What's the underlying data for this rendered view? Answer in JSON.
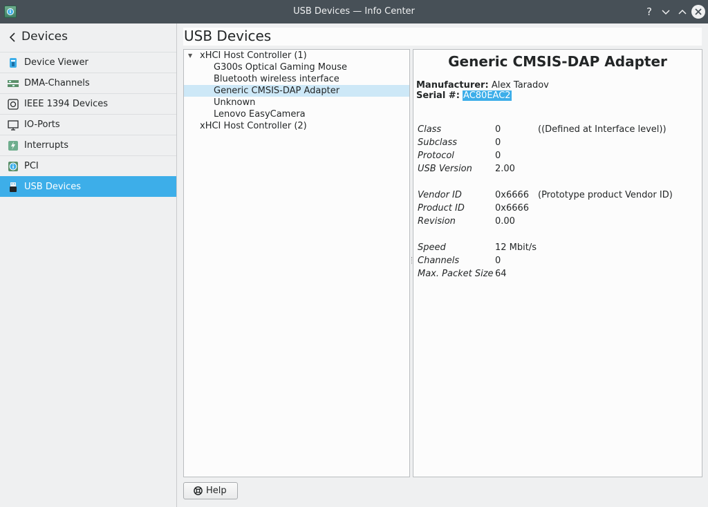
{
  "window": {
    "title": "USB Devices — Info Center"
  },
  "titlebar_buttons": {
    "help": "?",
    "minimize": "⌄",
    "maximize": "⌃",
    "close": "✕"
  },
  "sidebar": {
    "back_icon": "chevron-left-icon",
    "title": "Devices",
    "items": [
      {
        "label": "Device Viewer",
        "icon": "device-viewer-icon"
      },
      {
        "label": "DMA-Channels",
        "icon": "dma-channels-icon"
      },
      {
        "label": "IEEE 1394 Devices",
        "icon": "firewire-icon"
      },
      {
        "label": "IO-Ports",
        "icon": "monitor-icon"
      },
      {
        "label": "Interrupts",
        "icon": "interrupts-icon"
      },
      {
        "label": "PCI",
        "icon": "info-icon"
      },
      {
        "label": "USB Devices",
        "icon": "usb-icon",
        "active": true
      }
    ]
  },
  "main": {
    "title": "USB Devices",
    "tree": [
      {
        "label": "xHCI Host Controller (1)",
        "level": 0,
        "expanded": true
      },
      {
        "label": "G300s Optical Gaming Mouse",
        "level": 1
      },
      {
        "label": "Bluetooth wireless interface",
        "level": 1
      },
      {
        "label": "Generic CMSIS-DAP Adapter",
        "level": 1,
        "selected": true
      },
      {
        "label": "Unknown",
        "level": 1
      },
      {
        "label": "Lenovo EasyCamera",
        "level": 1
      },
      {
        "label": "xHCI Host Controller (2)",
        "level": 0
      }
    ],
    "details": {
      "title": "Generic CMSIS-DAP Adapter",
      "manufacturer_label": "Manufacturer:",
      "manufacturer": "Alex Taradov",
      "serial_label": "Serial #:",
      "serial": "AC80EAC2",
      "props": {
        "class_k": "Class",
        "class_v": "0",
        "class_n": "((Defined at Interface level))",
        "subclass_k": "Subclass",
        "subclass_v": "0",
        "protocol_k": "Protocol",
        "protocol_v": "0",
        "usbver_k": "USB Version",
        "usbver_v": "2.00",
        "vendor_k": "Vendor ID",
        "vendor_v": "0x6666",
        "vendor_n": "(Prototype product Vendor ID)",
        "product_k": "Product ID",
        "product_v": "0x6666",
        "revision_k": "Revision",
        "revision_v": "0.00",
        "speed_k": "Speed",
        "speed_v": "12 Mbit/s",
        "channels_k": "Channels",
        "channels_v": "0",
        "packet_k": "Max. Packet Size",
        "packet_v": "64"
      }
    },
    "help_button": {
      "label": "Help",
      "icon": "help-lifebuoy-icon"
    }
  },
  "colors": {
    "accent": "#3daee9",
    "titlebar": "#475057",
    "selection_light": "#cde8f7"
  }
}
